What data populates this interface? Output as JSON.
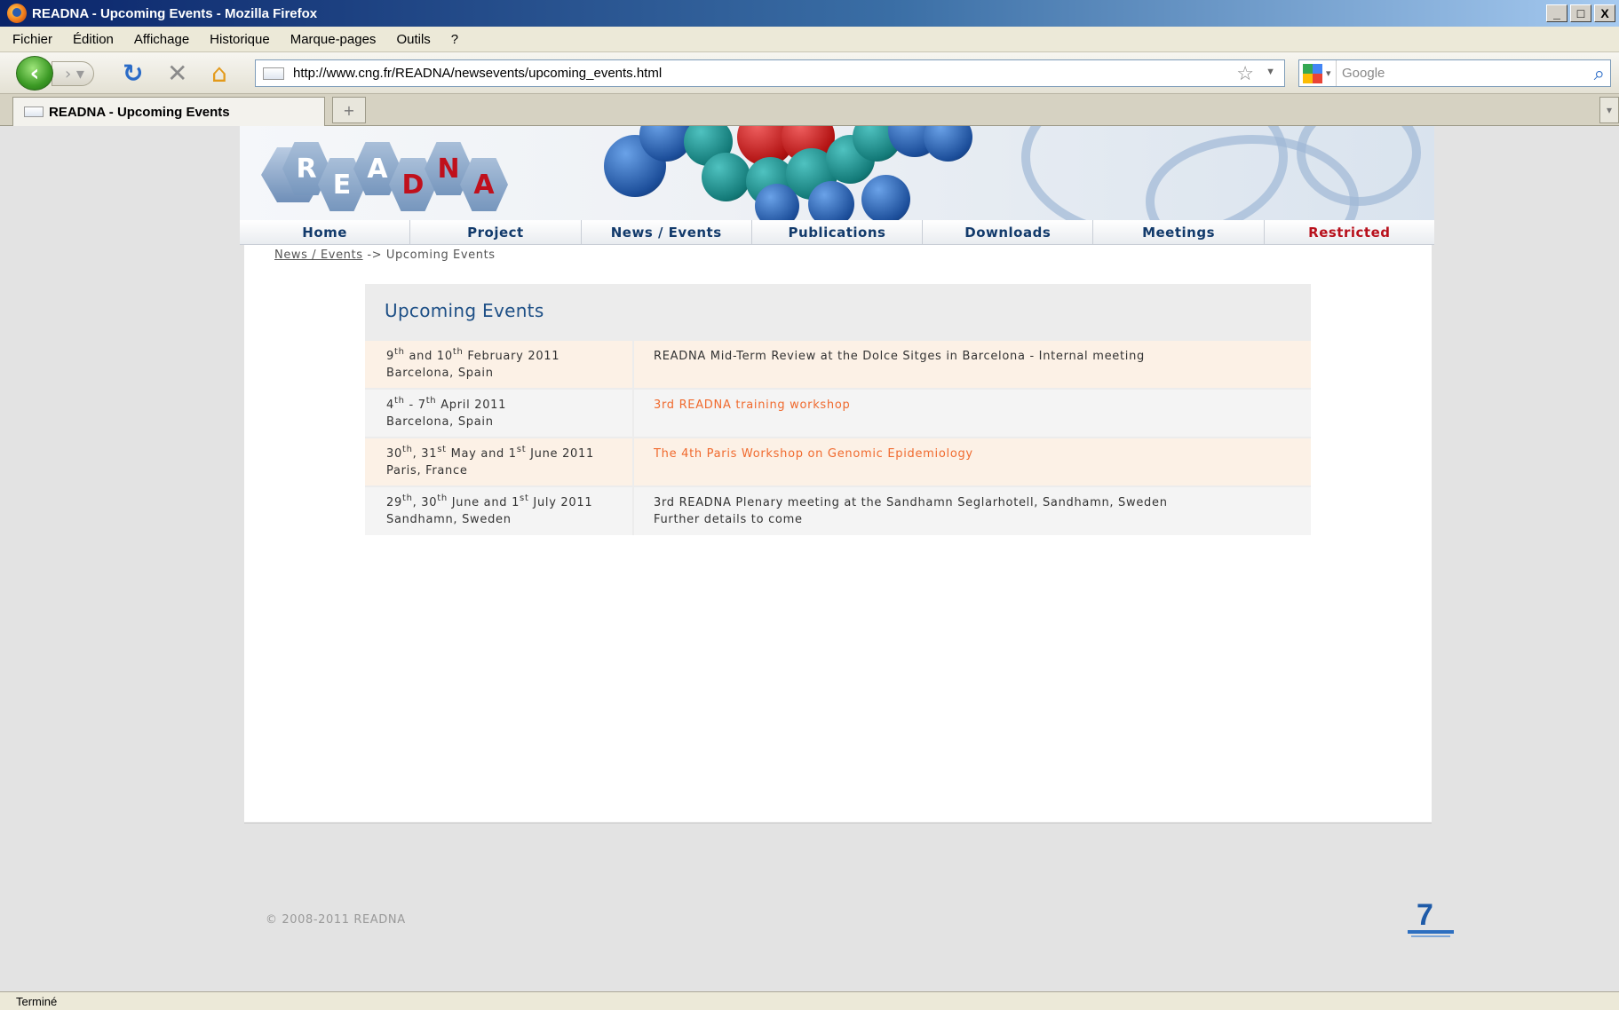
{
  "window": {
    "title": "READNA - Upcoming Events - Mozilla Firefox",
    "controls": [
      "_",
      "□",
      "X"
    ]
  },
  "menu": [
    "Fichier",
    "Édition",
    "Affichage",
    "Historique",
    "Marque-pages",
    "Outils",
    "?"
  ],
  "toolbar": {
    "url": "http://www.cng.fr/READNA/newsevents/upcoming_events.html",
    "search_placeholder": "Google"
  },
  "tabs": [
    {
      "label": "READNA - Upcoming Events"
    }
  ],
  "site": {
    "logo_letters": [
      "R",
      "E",
      "A",
      "D",
      "N",
      "A"
    ],
    "nav": [
      "Home",
      "Project",
      "News / Events",
      "Publications",
      "Downloads",
      "Meetings",
      "Restricted"
    ],
    "breadcrumb": {
      "link": "News / Events",
      "separator": "->",
      "current": "Upcoming Events"
    },
    "section_title": "Upcoming Events",
    "events": [
      {
        "date_parts": [
          "9",
          "th",
          " and 10",
          "th",
          " February 2011"
        ],
        "location": "Barcelona, Spain",
        "description": "READNA Mid-Term Review at the Dolce Sitges in Barcelona - Internal meeting",
        "description2": "",
        "is_link": false
      },
      {
        "date_parts": [
          "4",
          "th",
          " - 7",
          "th",
          " April 2011"
        ],
        "location": "Barcelona, Spain",
        "description": "3rd READNA training workshop",
        "description2": "",
        "is_link": true
      },
      {
        "date_parts": [
          "30",
          "th",
          ", 31",
          "st",
          " May and 1",
          "st",
          " June 2011"
        ],
        "location": "Paris, France",
        "description": "The 4th Paris Workshop on Genomic Epidemiology",
        "description2": "",
        "is_link": true
      },
      {
        "date_parts": [
          "29",
          "th",
          ", 30",
          "th",
          " June and 1",
          "st",
          " July 2011"
        ],
        "location": "Sandhamn, Sweden",
        "description": "3rd READNA Plenary meeting at the Sandhamn Seglarhotell, Sandhamn, Sweden",
        "description2": "Further details to come",
        "is_link": false
      }
    ],
    "footer_copyright": "© 2008-2011 READNA"
  },
  "status": "Terminé",
  "colors": {
    "nav_text": "#123a6b",
    "restricted": "#b8101c",
    "link": "#f06a2e",
    "title": "#1d4f86"
  }
}
